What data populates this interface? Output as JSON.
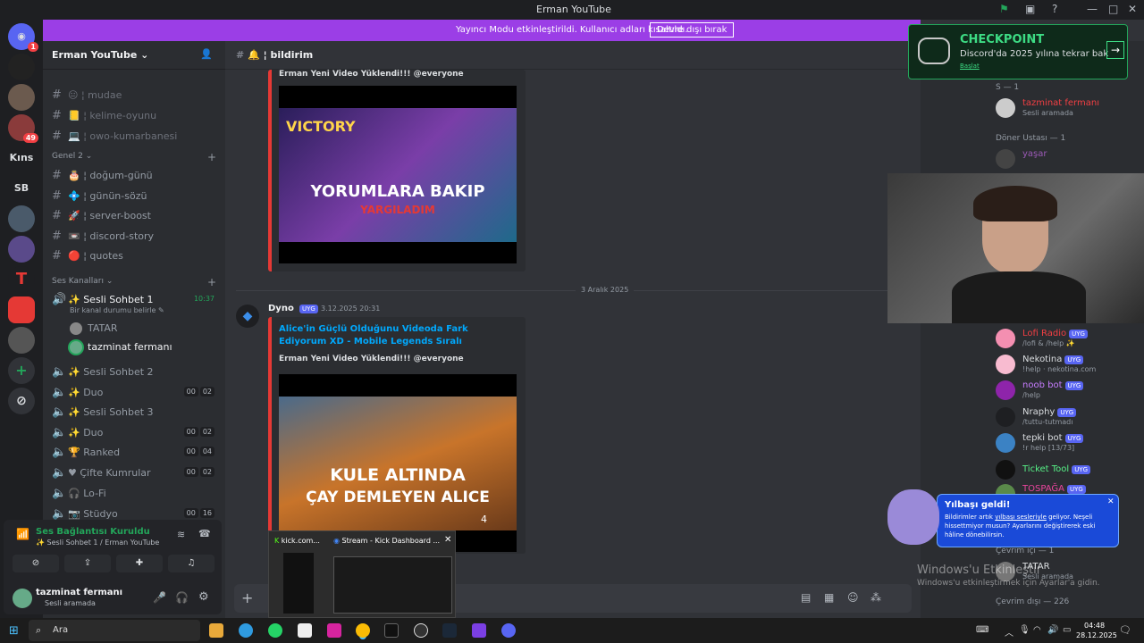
{
  "window": {
    "title": "Erman YouTube"
  },
  "banner": {
    "text": "Yayıncı Modu etkinleştirildi. Kullanıcı adları kısaltıldı.",
    "button": "Devre dışı bırak"
  },
  "servers": {
    "discord_badge": "1",
    "items": [
      {
        "label": "Kıns",
        "badge": ""
      },
      {
        "label": "SB",
        "badge": ""
      }
    ],
    "badge49": "49"
  },
  "sidebar": {
    "server_name": "Erman YouTube",
    "text_channels_top": [
      {
        "label": "mudae",
        "emoji": "😐"
      },
      {
        "label": "kelime-oyunu",
        "emoji": "📒"
      },
      {
        "label": "owo-kumarbanesi",
        "emoji": "💻"
      }
    ],
    "category_general": "Genel 2",
    "text_channels": [
      {
        "label": "doğum-günü",
        "emoji": "🎂"
      },
      {
        "label": "günün-sözü",
        "emoji": "💠"
      },
      {
        "label": "server-boost",
        "emoji": "🚀"
      },
      {
        "label": "discord-story",
        "emoji": "📼"
      },
      {
        "label": "quotes",
        "emoji": "🔴"
      }
    ],
    "category_voice": "Ses Kanalları",
    "voice_active": {
      "label": "Sesli Sohbet 1",
      "time": "10:37",
      "status": "Bir kanal durumu belirle"
    },
    "voice_users": [
      "TATAR",
      "tazminat fermanı"
    ],
    "voice_channels": [
      {
        "label": "Sesli Sohbet 2",
        "c1": "",
        "c2": ""
      },
      {
        "label": "Duo",
        "c1": "00",
        "c2": "02"
      },
      {
        "label": "Sesli Sohbet 3",
        "c1": "",
        "c2": ""
      },
      {
        "label": "Duo",
        "c1": "00",
        "c2": "02"
      },
      {
        "label": "Ranked",
        "c1": "00",
        "c2": "04"
      },
      {
        "label": "Çifte Kumrular",
        "c1": "00",
        "c2": "02"
      },
      {
        "label": "Lo-Fi",
        "c1": "",
        "c2": ""
      },
      {
        "label": "Stüdyo",
        "c1": "00",
        "c2": "16"
      }
    ]
  },
  "voice_connection": {
    "title": "Ses Bağlantısı Kuruldu",
    "channel": "Sesli Sohbet 1 / Erman YouTube"
  },
  "user": {
    "name": "tazminat fermanı",
    "status": "Sesli aramada"
  },
  "channel_header": {
    "name": "bildirim"
  },
  "messages": {
    "first_embed_mention": "Erman Yeni Video Yüklendi!!! @everyone",
    "first_thumbnail": {
      "top": "VICTORY",
      "main": "YORUMLARA BAKIP",
      "sub": "YARGILADIM"
    },
    "date_divider": "3 Aralık 2025",
    "second": {
      "author": "Dyno",
      "tag": "UYG",
      "time": "3.12.2025 20:31",
      "title": "Alice'in Güçlü Olduğunu Videoda Fark Ediyorum XD - Mobile Legends Sıralı",
      "desc": "Erman Yeni Video Yüklendi!!! @everyone",
      "thumb1": "KULE ALTINDA",
      "thumb2": "ÇAY DEMLEYEN ALICE",
      "thumb_small": "4"
    }
  },
  "taskbar_preview": {
    "tab1": "kick.com...",
    "tab2": "Stream - Kick Dashboard ..."
  },
  "promo": {
    "title": "CHECKPOINT",
    "text": "Discord'da 2025 yılına tekrar bak",
    "link": "Başlat"
  },
  "members": {
    "top_group": "S — 1",
    "top_user": {
      "name": "tazminat fermanı",
      "status": "Sesli aramada"
    },
    "group2": "Döner Ustası — 1",
    "group2_user": "yaşar",
    "bots": [
      {
        "name": "Lofi Radio",
        "status": "/lofi & /help ✨",
        "color": "#f23f43"
      },
      {
        "name": "Nekotina",
        "status": "!help · nekotina.com",
        "color": "#dbdee1"
      },
      {
        "name": "noob bot",
        "status": "/help",
        "color": "#c77dff"
      },
      {
        "name": "Nraphy",
        "status": "/tuttu-tutmadı",
        "color": "#dbdee1"
      },
      {
        "name": "tepki bot",
        "status": "!r help [13/73]",
        "color": "#dbdee1"
      },
      {
        "name": "Ticket Tool",
        "status": "",
        "color": "#57f287"
      },
      {
        "name": "TOSPAĞA",
        "status": "",
        "color": "#eb459e"
      }
    ],
    "bot_tag": "UYG",
    "online_header": "Çevrim içi — 1",
    "online_user": "TATAR",
    "online_user_status": "Sesli aramada",
    "offline_header": "Çevrim dışı — 226"
  },
  "popup": {
    "title": "Yılbaşı geldi!",
    "text_before": "Bildirimler artık ",
    "text_link": "yılbaşı sesleriyle",
    "text_after": " geliyor. Neşeli hissettmiyor musun? Ayarlarını değiştirerek eski hâline dönebilirsin."
  },
  "watermark": {
    "line1": "Windows'u Etkinleştir",
    "line2": "Windows'u etkinleştirmek için Ayarlar'a gidin."
  },
  "taskbar": {
    "search": "Ara",
    "time": "04:48",
    "date": "28.12.2025"
  },
  "colors": {
    "accent": "#5865f2",
    "banner": "#9b3ee6",
    "green": "#23a55a",
    "embed_border": "#e53935"
  }
}
